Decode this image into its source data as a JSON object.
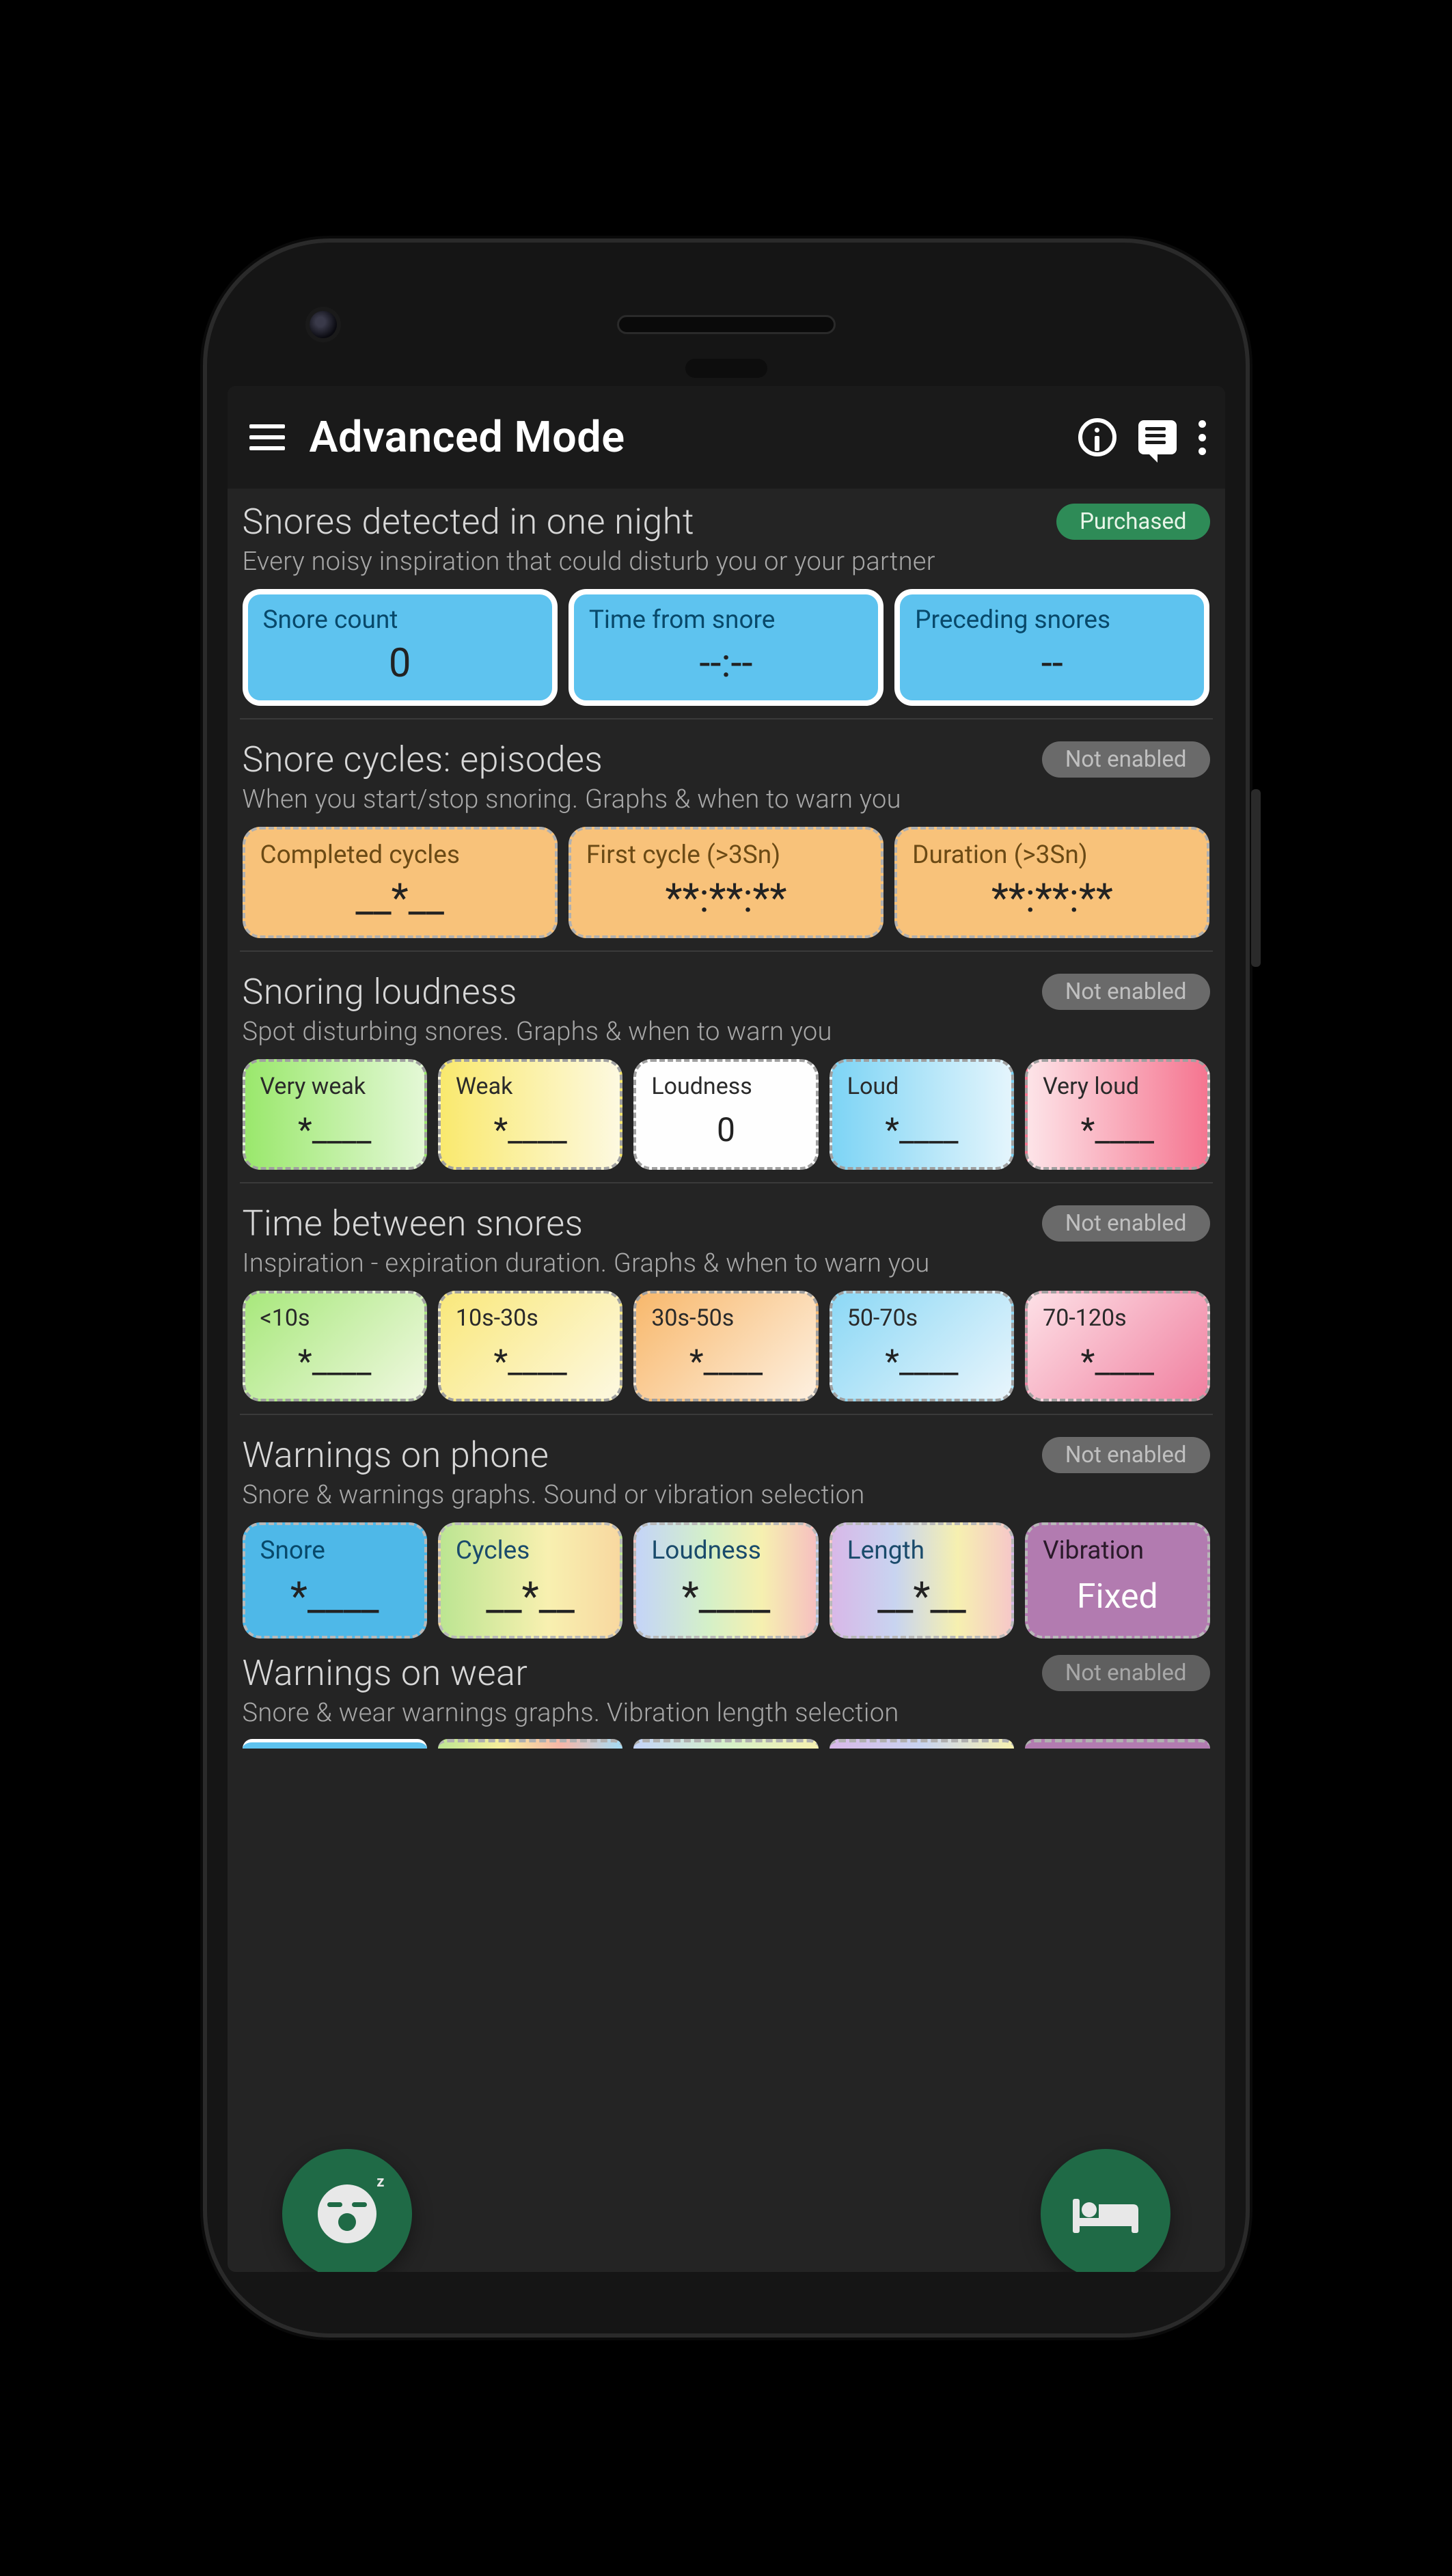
{
  "appbar": {
    "title": "Advanced Mode"
  },
  "badges": {
    "purchased": "Purchased",
    "not_enabled": "Not enabled"
  },
  "sections": {
    "snores_detected": {
      "title": "Snores detected in one night",
      "subtitle": "Every noisy inspiration that could disturb you or your partner",
      "cards": [
        {
          "label": "Snore count",
          "value": "0"
        },
        {
          "label": "Time from snore",
          "value": "--:--"
        },
        {
          "label": "Preceding snores",
          "value": "--"
        }
      ]
    },
    "snore_cycles": {
      "title": "Snore cycles: episodes",
      "subtitle": "When you start/stop snoring. Graphs & when to warn you",
      "cards": [
        {
          "label": "Completed cycles",
          "value": "__*__"
        },
        {
          "label": "First cycle (>3Sn)",
          "value": "**:**:**"
        },
        {
          "label": "Duration (>3Sn)",
          "value": "**:**:**"
        }
      ]
    },
    "loudness": {
      "title": "Snoring loudness",
      "subtitle": "Spot disturbing snores. Graphs & when to warn you",
      "cards": [
        {
          "label": "Very weak",
          "value": "*____"
        },
        {
          "label": "Weak",
          "value": "*____"
        },
        {
          "label": "Loudness",
          "value": "0"
        },
        {
          "label": "Loud",
          "value": "*____"
        },
        {
          "label": "Very loud",
          "value": "*____"
        }
      ]
    },
    "time_between": {
      "title": "Time between snores",
      "subtitle": "Inspiration - expiration duration. Graphs & when to warn you",
      "cards": [
        {
          "label": "<10s",
          "value": "*____"
        },
        {
          "label": "10s-30s",
          "value": "*____"
        },
        {
          "label": "30s-50s",
          "value": "*____"
        },
        {
          "label": "50-70s",
          "value": "*____"
        },
        {
          "label": "70-120s",
          "value": "*____"
        }
      ]
    },
    "warnings_phone": {
      "title": "Warnings on phone",
      "subtitle": "Snore & warnings graphs. Sound or vibration selection",
      "cards": [
        {
          "label": "Snore",
          "value": "*____"
        },
        {
          "label": "Cycles",
          "value": "__*__"
        },
        {
          "label": "Loudness",
          "value": "*____"
        },
        {
          "label": "Length",
          "value": "__*__"
        },
        {
          "label": "Vibration",
          "value": "Fixed"
        }
      ]
    },
    "warnings_wear": {
      "title": "Warnings on wear",
      "subtitle": "Snore & wear warnings graphs. Vibration length selection"
    }
  }
}
